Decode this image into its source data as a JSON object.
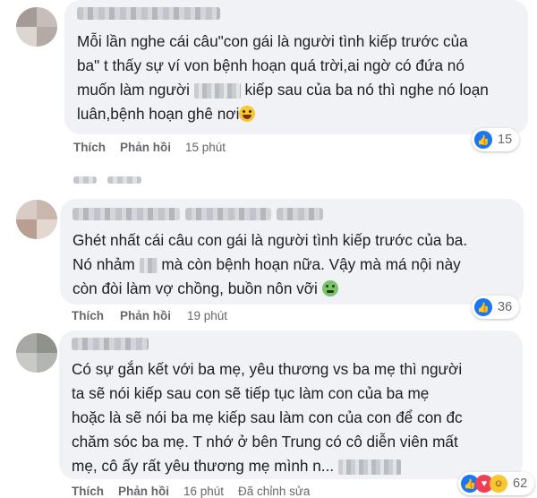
{
  "comments": [
    {
      "lines": [
        "Mỗi lần nghe cái câu\"con gái là người tình kiếp trước của",
        "ba\" t thấy sự ví von bệnh hoạn quá trời,ai ngờ có đứa nó",
        "muốn làm người",
        "kiếp sau của ba nó thì nghe nó loạn",
        "luân,bệnh hoạn ghê nơi"
      ],
      "emoji": "laughing-emoji",
      "like_label": "Thích",
      "reply_label": "Phản hồi",
      "time": "15 phút",
      "reaction_count": "15",
      "reaction_icons": [
        "like-icon"
      ]
    },
    {
      "lines": [
        "Ghét nhất cái câu con gái là người tình kiếp trước của ba.",
        "Nó nhảm",
        "mà còn bệnh hoạn nữa. Vậy mà má nội này",
        "còn đòi làm vợ chồng, buồn nôn vỡi"
      ],
      "emoji": "nauseated-emoji",
      "like_label": "Thích",
      "reply_label": "Phản hồi",
      "time": "19 phút",
      "reaction_count": "36",
      "reaction_icons": [
        "like-icon"
      ]
    },
    {
      "lines": [
        "Có sự gắn kết với ba mẹ, yêu thương vs ba mẹ thì người",
        "ta sẽ nói kiếp sau con sẽ tiếp tục làm con của ba mẹ",
        "hoặc là sẽ nói ba mẹ kiếp sau làm con của con để con đc",
        "chăm sóc ba mẹ. T nhớ ở bên Trung có cô diễn viên mất",
        "mẹ, cô ấy rất yêu thương mẹ mình n..."
      ],
      "like_label": "Thích",
      "reply_label": "Phản hồi",
      "time": "16 phút",
      "edited_label": "Đã chỉnh sửa",
      "reaction_count": "62",
      "reaction_icons": [
        "like-icon",
        "love-icon",
        "haha-icon"
      ]
    }
  ],
  "colors": {
    "bubble": "#f0f2f5",
    "text": "#1c1e21",
    "meta": "#65676b",
    "like_blue": "#1877f2",
    "love_red": "#f33e58"
  }
}
